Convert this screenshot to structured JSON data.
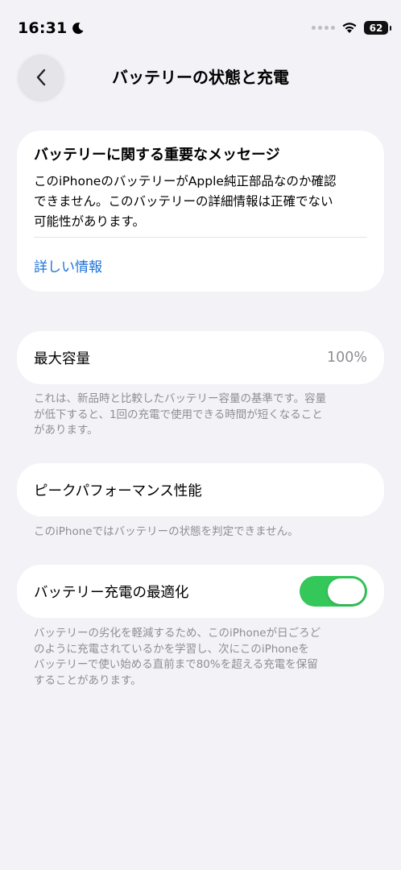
{
  "status_bar": {
    "time": "16:31",
    "battery": "62"
  },
  "nav": {
    "title": "バッテリーの状態と充電"
  },
  "important_message": {
    "title": "バッテリーに関する重要なメッセージ",
    "body_lines": [
      "このiPhoneのバッテリーがApple純正部品なのか確認",
      "できません。このバッテリーの詳細情報は正確でない",
      "可能性があります。"
    ],
    "link": "詳しい情報"
  },
  "max_capacity": {
    "label": "最大容量",
    "value": "100%",
    "footnote_lines": [
      "これは、新品時と比較したバッテリー容量の基準です。容量",
      "が低下すると、1回の充電で使用できる時間が短くなること",
      "があります。"
    ]
  },
  "peak_performance": {
    "label": "ピークパフォーマンス性能",
    "footnote": "このiPhoneではバッテリーの状態を判定できません。"
  },
  "optimized_charging": {
    "label": "バッテリー充電の最適化",
    "enabled": true,
    "toggle_color": "#34C759",
    "footnote_lines": [
      "バッテリーの劣化を軽減するため、このiPhoneが日ごろど",
      "のように充電されているかを学習し、次にこのiPhoneを",
      "バッテリーで使い始める直前まで80%を超える充電を保留",
      "することがあります。"
    ]
  }
}
